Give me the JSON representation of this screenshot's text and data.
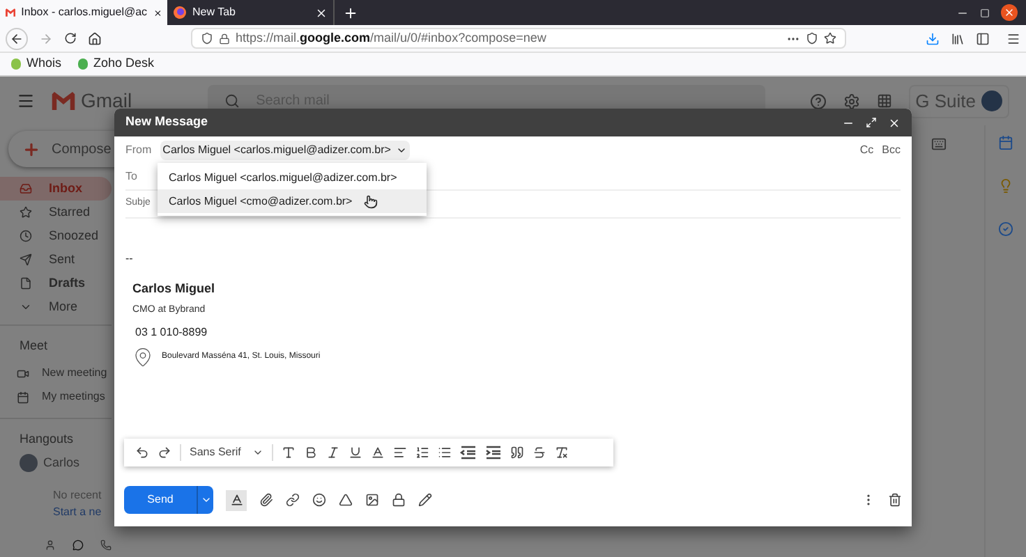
{
  "browser": {
    "tabs": [
      {
        "title": "Inbox - carlos.miguel@ac",
        "selected": true,
        "kind": "gmail"
      },
      {
        "title": "New Tab",
        "selected": false,
        "kind": "firefox"
      }
    ],
    "url": "https://mail.**google.com**/mail/u/0/#inbox?compose=new",
    "bookmarks": [
      {
        "label": "Whois",
        "color": "#8bc34a"
      },
      {
        "label": "Zoho Desk",
        "color": "#4caf50"
      }
    ]
  },
  "gmail": {
    "logo": "Gmail",
    "search": {
      "placeholder": "Search mail"
    },
    "suite": "G Suite",
    "compose": "Compose",
    "nav": [
      {
        "label": "Inbox",
        "selected": true,
        "bold": true,
        "kind": "inbox"
      },
      {
        "label": "Starred",
        "selected": false,
        "bold": false,
        "kind": "star"
      },
      {
        "label": "Snoozed",
        "selected": false,
        "bold": false,
        "kind": "clock"
      },
      {
        "label": "Sent",
        "selected": false,
        "bold": false,
        "kind": "send"
      },
      {
        "label": "Drafts",
        "selected": false,
        "bold": true,
        "kind": "file"
      },
      {
        "label": "More",
        "selected": false,
        "bold": false,
        "kind": "more"
      }
    ],
    "meet": {
      "title": "Meet",
      "items": [
        {
          "label": "New meeting",
          "kind": "video"
        },
        {
          "label": "My meetings",
          "kind": "calendar"
        }
      ]
    },
    "hangouts": {
      "title": "Hangouts",
      "user": "Carlos",
      "empty": "No recent",
      "start": "Start a ne"
    }
  },
  "compose": {
    "title": "New Message",
    "from_label": "From",
    "from_value": "Carlos Miguel <carlos.miguel@adizer.com.br>",
    "to_label": "To",
    "subject_label": "Subje",
    "cc": "Cc",
    "bcc": "Bcc",
    "from_options": [
      {
        "label": "Carlos Miguel <carlos.miguel@adizer.com.br>",
        "selected": false
      },
      {
        "label": "Carlos Miguel <cmo@adizer.com.br>",
        "selected": true
      }
    ],
    "signature": {
      "dash": "--",
      "name": "Carlos Miguel",
      "role": "CMO at Bybrand",
      "phone": "03 1 010-8899",
      "address": "Boulevard Masséna 41, St. Louis, Missouri"
    },
    "font": "Sans Serif",
    "send": "Send"
  }
}
